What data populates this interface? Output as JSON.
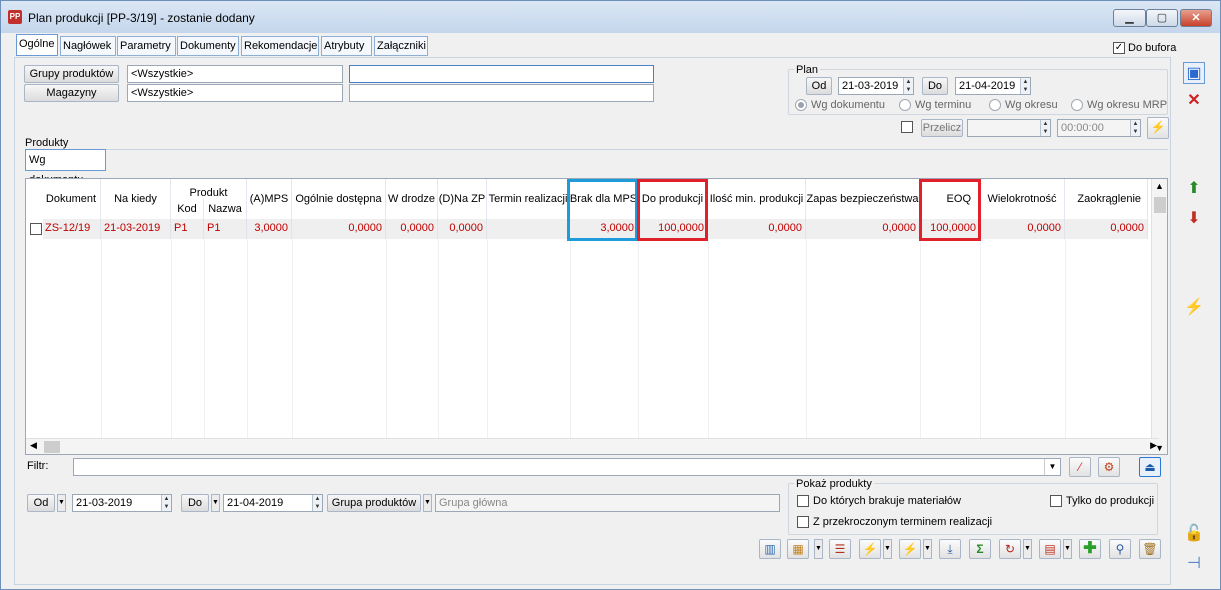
{
  "window": {
    "title": "Plan produkcji [PP-3/19] - zostanie dodany",
    "app_icon": "PP",
    "min": "▁",
    "max": "▢",
    "close": "✕"
  },
  "tabs": [
    "Ogólne",
    "Nagłówek",
    "Parametry",
    "Dokumenty",
    "Rekomendacje",
    "Atrybuty",
    "Załączniki"
  ],
  "do_bufora": {
    "label": "Do bufora",
    "checked": true
  },
  "filters": {
    "grupy_btn": "Grupy produktów",
    "grupy_value": "<Wszystkie>",
    "grupy_extra": "",
    "magazyny_btn": "Magazyny",
    "magazyny_value": "<Wszystkie>",
    "magazyny_extra": ""
  },
  "plan": {
    "title": "Plan",
    "od_btn": "Od",
    "od_date": "21-03-2019",
    "do_btn": "Do",
    "do_date": "21-04-2019",
    "radios": [
      "Wg dokumentu",
      "Wg terminu",
      "Wg okresu",
      "Wg okresu MRP"
    ],
    "selected": 0,
    "przelicz": "Przelicz",
    "time": "00:00:00"
  },
  "produkty": {
    "title": "Produkty",
    "subtab": "Wg dokumentu"
  },
  "grid": {
    "headers": [
      "Dokument",
      "Na kiedy",
      "Produkt",
      "Kod",
      "Nazwa",
      "(A)MPS",
      "Ogólnie dostępna",
      "W drodze",
      "(D)Na ZP",
      "Termin realizacji",
      "Brak dla MPS",
      "Do produkcji",
      "Ilość min. produkcji",
      "Zapas bezpieczeństwa",
      "EOQ",
      "Wielokrotność",
      "Zaokrąglenie"
    ],
    "row": [
      "ZS-12/19",
      "21-03-2019",
      "P1",
      "P1",
      "3,0000",
      "0,0000",
      "0,0000",
      "0,0000",
      "",
      "3,0000",
      "100,0000",
      "0,0000",
      "0,0000",
      "100,0000",
      "0,0000",
      "0,0000"
    ],
    "highlight_blue": "#1e9bd8",
    "highlight_red": "#e0202a",
    "row_text_color": "#c00000"
  },
  "filtr": {
    "label": "Filtr:",
    "value": ""
  },
  "bottom": {
    "od_btn": "Od",
    "od_date": "21-03-2019",
    "do_btn": "Do",
    "do_date": "21-04-2019",
    "grupa_btn": "Grupa produktów",
    "grupa_value": "Grupa główna"
  },
  "pokaz": {
    "title": "Pokaż produkty",
    "opt1": "Do których brakuje materiałów",
    "opt2": "Tylko do produkcji",
    "opt3": "Z przekroczonym terminem realizacji"
  },
  "icons": {
    "save": "save-icon",
    "cancel": "cancel-icon",
    "chart": "chart-icon",
    "lightning": "lightning-icon",
    "sum": "sum-icon",
    "add": "add-icon",
    "search": "search-icon",
    "delete": "delete-icon",
    "lock": "lock-icon",
    "pin": "pin-icon"
  }
}
